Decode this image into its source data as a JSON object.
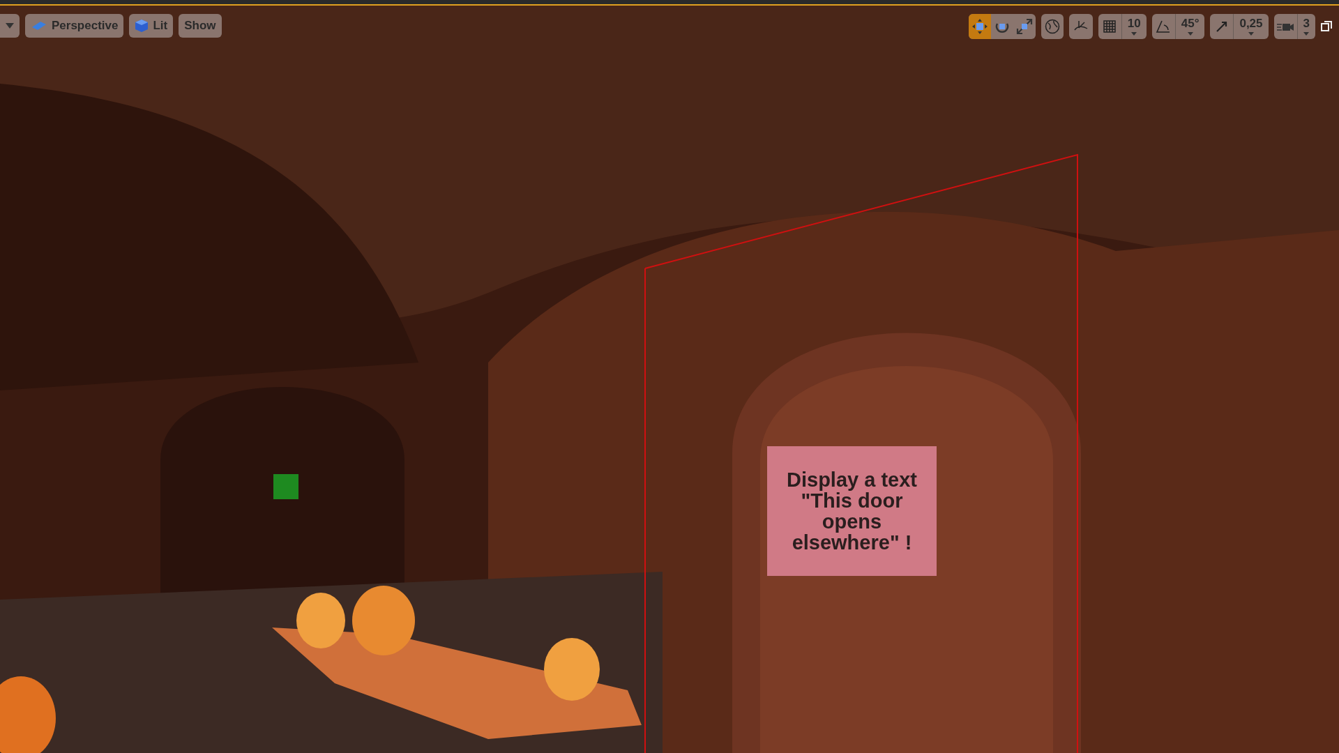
{
  "toolbar_left": [
    {
      "kind": "dropdown"
    },
    {
      "kind": "perspective",
      "label": "Perspective"
    },
    {
      "kind": "lit",
      "label": "Lit"
    },
    {
      "kind": "plain",
      "label": "Show"
    }
  ],
  "transform_tools": [
    {
      "kind": "move",
      "selected": true
    },
    {
      "kind": "rotate",
      "selected": false
    },
    {
      "kind": "scale",
      "selected": false
    }
  ],
  "snap": [
    {
      "kind": "grid",
      "value": "10"
    },
    {
      "kind": "angle",
      "value": "45°"
    },
    {
      "kind": "scale",
      "value": "0,25"
    },
    {
      "kind": "camera",
      "value": "3"
    }
  ],
  "sign": {
    "text": "Display a text  \"This door opens elsewhere\" !"
  }
}
